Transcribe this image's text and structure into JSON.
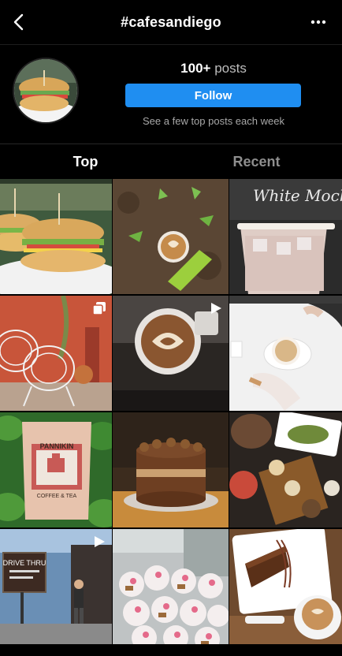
{
  "nav": {
    "title": "#cafesandiego",
    "back_icon": "chevron-left-icon",
    "more_icon": "more-horizontal-icon"
  },
  "header": {
    "posts_count": "100+",
    "posts_label": "posts",
    "follow_label": "Follow",
    "subtext": "See a few top posts each week",
    "follow_color": "#1f8ef1"
  },
  "tabs": [
    {
      "label": "Top",
      "active": true
    },
    {
      "label": "Recent",
      "active": false
    }
  ],
  "posts": [
    {
      "subject": "sandwich"
    },
    {
      "subject": "latte-plants"
    },
    {
      "subject": "iced-drink",
      "text": "White Mocha"
    },
    {
      "subject": "patio-chairs",
      "badge": "carousel-icon"
    },
    {
      "subject": "latte-art",
      "badge": "video-icon"
    },
    {
      "subject": "cappuccino-table"
    },
    {
      "subject": "coffee-bag",
      "text1": "PANNIKIN",
      "text2": "COFFEE & TEA"
    },
    {
      "subject": "chocolate-cake"
    },
    {
      "subject": "food-flatlay"
    },
    {
      "subject": "drive-thru",
      "badge": "video-icon",
      "text": "DRIVE THRU"
    },
    {
      "subject": "cupcakes"
    },
    {
      "subject": "cake-slice"
    }
  ]
}
